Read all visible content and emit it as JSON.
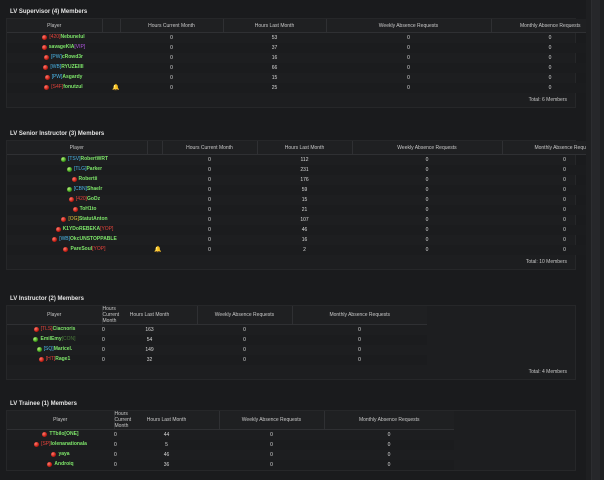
{
  "columns": [
    "Player",
    "Hours Current Month",
    "Hours Last Month",
    "Weekly Absence Requests",
    "Monthly Absence Requests"
  ],
  "sections": [
    {
      "title": "LV Supervisor (4) Members",
      "total": "Total: 6 Members",
      "rows": [
        {
          "status": "red",
          "tag": "[420]",
          "tag_color": "#e5433a",
          "name": "Nebunelul",
          "suffix": "",
          "suffix_color": "",
          "bell": false,
          "hcm": "0",
          "hlm": "53",
          "war": "0",
          "mar": "0"
        },
        {
          "status": "red",
          "tag": "",
          "tag_color": "",
          "name": "savageKIA",
          "suffix": "[VIP]",
          "suffix_color": "#b057e0",
          "bell": false,
          "hcm": "0",
          "hlm": "37",
          "war": "0",
          "mar": "0"
        },
        {
          "status": "red",
          "tag": "[PW]",
          "tag_color": "#4ab6e8",
          "name": "cRowd3r",
          "suffix": "",
          "suffix_color": "",
          "bell": false,
          "hcm": "0",
          "hlm": "16",
          "war": "0",
          "mar": "0"
        },
        {
          "status": "red",
          "tag": "[WB]",
          "tag_color": "#4ab6e8",
          "name": "RYUZEIIII",
          "suffix": "",
          "suffix_color": "",
          "bell": false,
          "hcm": "0",
          "hlm": "66",
          "war": "0",
          "mar": "0"
        },
        {
          "status": "red",
          "tag": "[PW]",
          "tag_color": "#4ab6e8",
          "name": "Asgardy",
          "suffix": "",
          "suffix_color": "",
          "bell": false,
          "hcm": "0",
          "hlm": "15",
          "war": "0",
          "mar": "0"
        },
        {
          "status": "red",
          "tag": "[S4F]",
          "tag_color": "#e5433a",
          "name": "fonutzul",
          "suffix": "",
          "suffix_color": "",
          "bell": true,
          "hcm": "0",
          "hlm": "25",
          "war": "0",
          "mar": "0"
        }
      ]
    },
    {
      "title": "LV Senior Instructor (3) Members",
      "total": "Total: 10 Members",
      "rows": [
        {
          "status": "green",
          "tag": "[TSV]",
          "tag_color": "#4ab6e8",
          "name": "RobertWRT",
          "suffix": "",
          "suffix_color": "",
          "bell": false,
          "hcm": "0",
          "hlm": "112",
          "war": "0",
          "mar": "0"
        },
        {
          "status": "green",
          "tag": "[TLG]",
          "tag_color": "#4ab6e8",
          "name": "Parker",
          "suffix": "",
          "suffix_color": "",
          "bell": false,
          "hcm": "0",
          "hlm": "231",
          "war": "0",
          "mar": "0"
        },
        {
          "status": "red",
          "tag": "",
          "tag_color": "",
          "name": "Robertii",
          "suffix": "",
          "suffix_color": "",
          "bell": false,
          "hcm": "0",
          "hlm": "176",
          "war": "0",
          "mar": "0"
        },
        {
          "status": "green",
          "tag": "[CBN]",
          "tag_color": "#4ab6e8",
          "name": "Shaelr",
          "suffix": "",
          "suffix_color": "",
          "bell": false,
          "hcm": "0",
          "hlm": "59",
          "war": "0",
          "mar": "0"
        },
        {
          "status": "red",
          "tag": "[420]",
          "tag_color": "#e5433a",
          "name": "GoDz",
          "suffix": "",
          "suffix_color": "",
          "bell": false,
          "hcm": "0",
          "hlm": "15",
          "war": "0",
          "mar": "0"
        },
        {
          "status": "red",
          "tag": "",
          "tag_color": "",
          "name": "ToH1to",
          "suffix": "",
          "suffix_color": "",
          "bell": false,
          "hcm": "0",
          "hlm": "21",
          "war": "0",
          "mar": "0"
        },
        {
          "status": "red",
          "tag": "[OG]",
          "tag_color": "#e5c43a",
          "name": "StatutAnton",
          "suffix": "",
          "suffix_color": "",
          "bell": false,
          "hcm": "0",
          "hlm": "107",
          "war": "0",
          "mar": "0"
        },
        {
          "status": "red",
          "tag": "",
          "tag_color": "",
          "name": "K1YDoREBEKA",
          "suffix": "[YOP]",
          "suffix_color": "#e5433a",
          "bell": false,
          "hcm": "0",
          "hlm": "46",
          "war": "0",
          "mar": "0"
        },
        {
          "status": "red",
          "tag": "[WB]",
          "tag_color": "#4ab6e8",
          "name": "OkcUNSTOPPABLE",
          "suffix": "",
          "suffix_color": "",
          "bell": false,
          "hcm": "0",
          "hlm": "16",
          "war": "0",
          "mar": "0"
        },
        {
          "status": "red",
          "tag": "",
          "tag_color": "",
          "name": "PareSoul",
          "suffix": "[YOP]",
          "suffix_color": "#e5433a",
          "bell": true,
          "hcm": "0",
          "hlm": "2",
          "war": "0",
          "mar": "0"
        }
      ]
    },
    {
      "title": "LV Instructor (2) Members",
      "total": "Total: 4 Members",
      "rows": [
        {
          "status": "red",
          "tag": "[TLS]",
          "tag_color": "#e5433a",
          "name": "Ciacnoris",
          "suffix": "",
          "suffix_color": "",
          "bell": false,
          "hcm": "0",
          "hlm": "163",
          "war": "0",
          "mar": "0"
        },
        {
          "status": "green",
          "tag": "",
          "tag_color": "",
          "name": "EmilEmy",
          "suffix": "[CON]",
          "suffix_color": "#4a7a3a",
          "bell": false,
          "hcm": "0",
          "hlm": "54",
          "war": "0",
          "mar": "0"
        },
        {
          "status": "green",
          "tag": "[SQ]",
          "tag_color": "#4ab6e8",
          "name": "Maricel.",
          "suffix": "",
          "suffix_color": "",
          "bell": false,
          "hcm": "0",
          "hlm": "149",
          "war": "0",
          "mar": "0"
        },
        {
          "status": "red",
          "tag": "[HT]",
          "tag_color": "#e5433a",
          "name": "Rage1",
          "suffix": "",
          "suffix_color": "",
          "bell": false,
          "hcm": "0",
          "hlm": "32",
          "war": "0",
          "mar": "0"
        }
      ]
    },
    {
      "title": "LV Trainee (1) Members",
      "total": "",
      "rows": [
        {
          "status": "red",
          "tag": "",
          "tag_color": "",
          "name": "TTbilo[ONE]",
          "suffix": "",
          "suffix_color": "",
          "bell": false,
          "hcm": "0",
          "hlm": "44",
          "war": "0",
          "mar": "0"
        },
        {
          "status": "red",
          "tag": "[SP]",
          "tag_color": "#e5433a",
          "name": "Iolenanationala",
          "suffix": "",
          "suffix_color": "",
          "bell": false,
          "hcm": "0",
          "hlm": "5",
          "war": "0",
          "mar": "0"
        },
        {
          "status": "red",
          "tag": "",
          "tag_color": "",
          "name": "yaya",
          "suffix": "",
          "suffix_color": "",
          "bell": false,
          "hcm": "0",
          "hlm": "46",
          "war": "0",
          "mar": "0"
        },
        {
          "status": "red",
          "tag": "",
          "tag_color": "",
          "name": "Androiq",
          "suffix": "",
          "suffix_color": "",
          "bell": false,
          "hcm": "0",
          "hlm": "36",
          "war": "0",
          "mar": "0"
        }
      ]
    }
  ]
}
